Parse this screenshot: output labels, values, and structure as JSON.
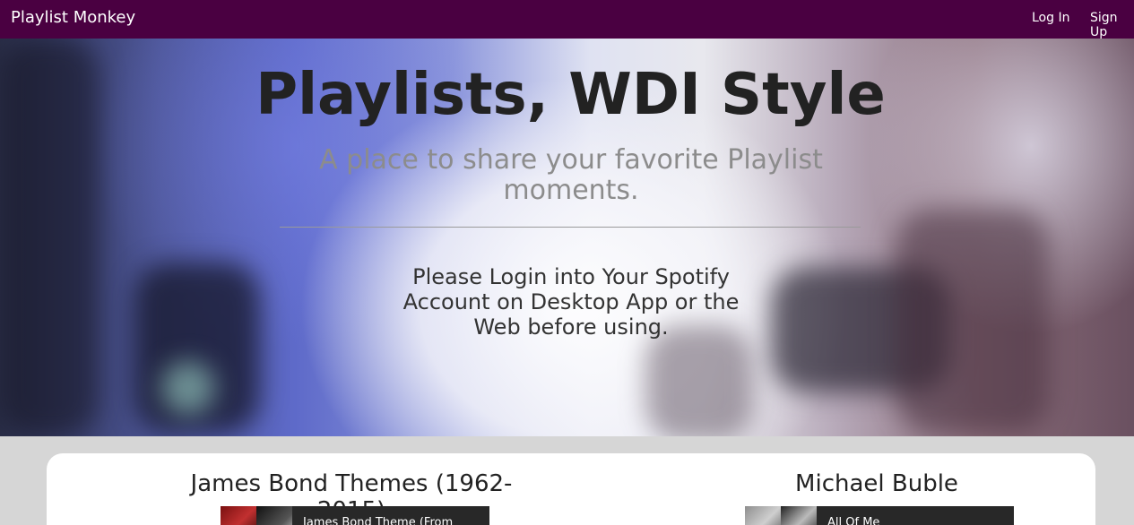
{
  "navbar": {
    "brand": "Playlist Monkey",
    "login": "Log In",
    "signup": "Sign Up",
    "bg_color": "#4a0041"
  },
  "hero": {
    "title": "Playlists, WDI Style",
    "subtitle": "A place to share your favorite Playlist moments.",
    "note": "Please Login into Your Spotify Account on Desktop App or the Web before using."
  },
  "playlists": [
    {
      "title": "James Bond Themes (1962-2015)",
      "track": "James Bond Theme (From"
    },
    {
      "title": "Michael Buble",
      "track": "All Of Me"
    }
  ]
}
